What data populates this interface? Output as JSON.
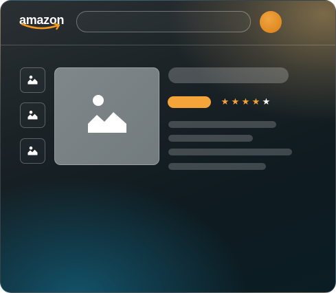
{
  "header": {
    "logo_text": "amazon",
    "logo_smile_color": "#f39a1f",
    "search_icon": "search-field",
    "avatar_color": "#e8922a"
  },
  "product": {
    "thumbnails": [
      {
        "icon": "image-icon"
      },
      {
        "icon": "image-icon"
      },
      {
        "icon": "image-icon"
      }
    ],
    "main_image_icon": "image-icon",
    "price_color": "#f5a43a",
    "rating": {
      "value": 4,
      "max": 5
    }
  },
  "colors": {
    "accent": "#f5a43a",
    "background_dark": "#0f1b20",
    "teal_glow": "#145c76"
  }
}
